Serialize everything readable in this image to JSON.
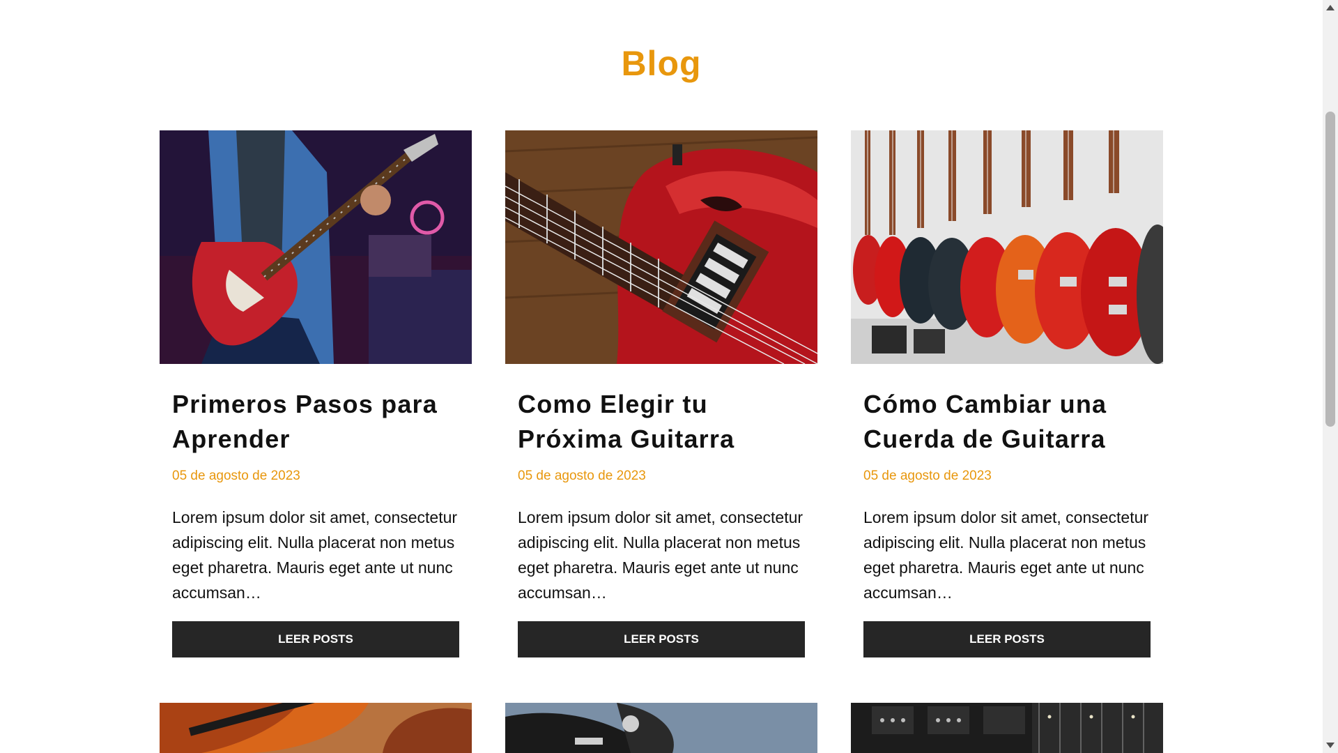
{
  "section": {
    "title": "Blog"
  },
  "posts": [
    {
      "title": "Primeros Pasos para Aprender",
      "date": "05 de agosto de 2023",
      "excerpt": "Lorem ipsum dolor sit amet, consectetur adipiscing elit. Nulla placerat non metus eget pharetra. Mauris eget ante ut nunc accumsan…",
      "button": "LEER POSTS",
      "image": "guitarist-playing-red-electric-guitar"
    },
    {
      "title": "Como Elegir tu Próxima Guitarra",
      "date": "05 de agosto de 2023",
      "excerpt": "Lorem ipsum dolor sit amet, consectetur adipiscing elit. Nulla placerat non metus eget pharetra. Mauris eget ante ut nunc accumsan…",
      "button": "LEER POSTS",
      "image": "red-guitar-closeup-on-wood"
    },
    {
      "title": "Cómo Cambiar una Cuerda de Guitarra",
      "date": "05 de agosto de 2023",
      "excerpt": "Lorem ipsum dolor sit amet, consectetur adipiscing elit. Nulla placerat non metus eget pharetra. Mauris eget ante ut nunc accumsan…",
      "button": "LEER POSTS",
      "image": "row-of-guitars-in-store"
    }
  ],
  "colors": {
    "accent": "#E8970D",
    "button_bg": "#262626",
    "text": "#111111"
  },
  "icons": {
    "scroll_up": "triangle-up-icon",
    "scroll_down": "triangle-down-icon"
  }
}
